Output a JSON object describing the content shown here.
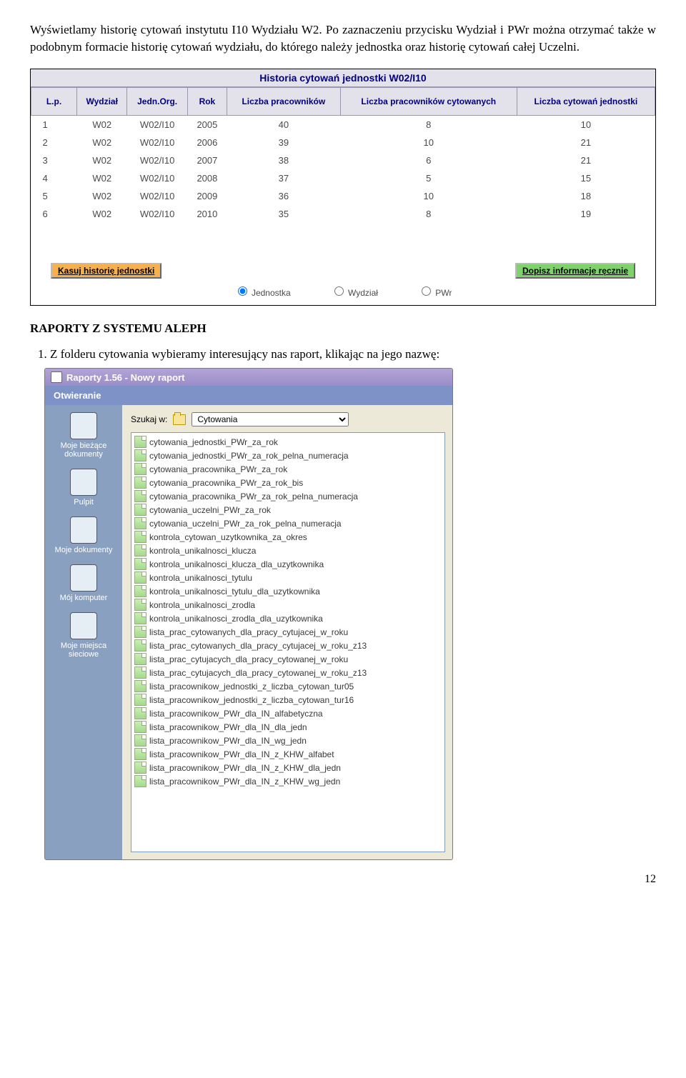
{
  "intro": "Wyświetlamy historię cytowań instytutu I10 Wydziału W2. Po zaznaczeniu przycisku Wydział i PWr można otrzymać także w podobnym formacie historię cytowań wydziału, do którego należy jednostka oraz historię cytowań całej Uczelni.",
  "grid": {
    "title": "Historia cytowań jednostki W02/I10",
    "headers": [
      "L.p.",
      "Wydział",
      "Jedn.Org.",
      "Rok",
      "Liczba pracowników",
      "Liczba pracowników cytowanych",
      "Liczba cytowań jednostki"
    ],
    "rows": [
      [
        "1",
        "W02",
        "W02/I10",
        "2005",
        "40",
        "8",
        "10"
      ],
      [
        "2",
        "W02",
        "W02/I10",
        "2006",
        "39",
        "10",
        "21"
      ],
      [
        "3",
        "W02",
        "W02/I10",
        "2007",
        "38",
        "6",
        "21"
      ],
      [
        "4",
        "W02",
        "W02/I10",
        "2008",
        "37",
        "5",
        "15"
      ],
      [
        "5",
        "W02",
        "W02/I10",
        "2009",
        "36",
        "10",
        "18"
      ],
      [
        "6",
        "W02",
        "W02/I10",
        "2010",
        "35",
        "8",
        "19"
      ]
    ],
    "btn_delete": "Kasuj historię jednostki",
    "btn_add": "Dopisz informacje ręcznie",
    "radios": [
      "Jednostka",
      "Wydział",
      "PWr"
    ]
  },
  "section_title": "RAPORTY Z SYSTEMU ALEPH",
  "list_item_1": "Z folderu cytowania wybieramy interesujący nas raport, klikając na jego nazwę:",
  "dialog": {
    "title": "Raporty 1.56   -  Nowy raport",
    "panel": "Otwieranie",
    "lookin_label": "Szukaj w:",
    "folder": "Cytowania",
    "places": [
      "Moje bieżące dokumenty",
      "Pulpit",
      "Moje dokumenty",
      "Mój komputer",
      "Moje miejsca sieciowe"
    ],
    "files": [
      "cytowania_jednostki_PWr_za_rok",
      "cytowania_jednostki_PWr_za_rok_pelna_numeracja",
      "cytowania_pracownika_PWr_za_rok",
      "cytowania_pracownika_PWr_za_rok_bis",
      "cytowania_pracownika_PWr_za_rok_pelna_numeracja",
      "cytowania_uczelni_PWr_za_rok",
      "cytowania_uczelni_PWr_za_rok_pelna_numeracja",
      "kontrola_cytowan_uzytkownika_za_okres",
      "kontrola_unikalnosci_klucza",
      "kontrola_unikalnosci_klucza_dla_uzytkownika",
      "kontrola_unikalnosci_tytulu",
      "kontrola_unikalnosci_tytulu_dla_uzytkownika",
      "kontrola_unikalnosci_zrodla",
      "kontrola_unikalnosci_zrodla_dla_uzytkownika",
      "lista_prac_cytowanych_dla_pracy_cytujacej_w_roku",
      "lista_prac_cytowanych_dla_pracy_cytujacej_w_roku_z13",
      "lista_prac_cytujacych_dla_pracy_cytowanej_w_roku",
      "lista_prac_cytujacych_dla_pracy_cytowanej_w_roku_z13",
      "lista_pracownikow_jednostki_z_liczba_cytowan_tur05",
      "lista_pracownikow_jednostki_z_liczba_cytowan_tur16",
      "lista_pracownikow_PWr_dla_IN_alfabetyczna",
      "lista_pracownikow_PWr_dla_IN_dla_jedn",
      "lista_pracownikow_PWr_dla_IN_wg_jedn",
      "lista_pracownikow_PWr_dla_IN_z_KHW_alfabet",
      "lista_pracownikow_PWr_dla_IN_z_KHW_dla_jedn",
      "lista_pracownikow_PWr_dla_IN_z_KHW_wg_jedn"
    ]
  },
  "pagenum": "12"
}
